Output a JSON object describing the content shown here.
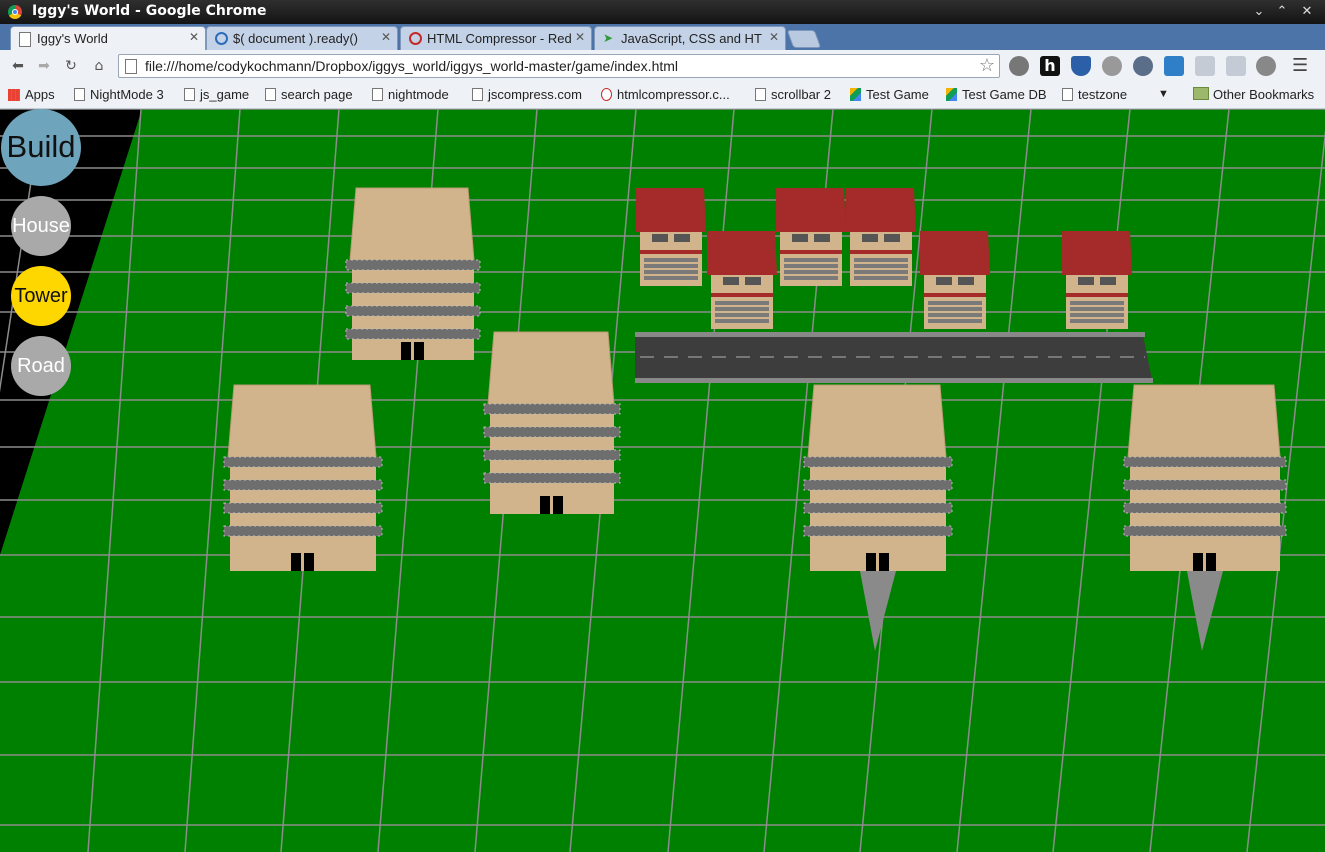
{
  "window": {
    "title": "Iggy's World - Google Chrome"
  },
  "tabs": [
    {
      "label": "Iggy's World",
      "active": true
    },
    {
      "label": "$( document ).ready()",
      "active": false
    },
    {
      "label": "HTML Compressor - Red",
      "active": false
    },
    {
      "label": "JavaScript, CSS and HT",
      "active": false
    }
  ],
  "address_bar": {
    "url": "file:///home/codykochmann/Dropbox/iggys_world/iggys_world-master/game/index.html"
  },
  "bookmarks": {
    "apps_label": "Apps",
    "items": [
      "NightMode 3",
      "js_game",
      "search page",
      "nightmode",
      "jscompress.com",
      "htmlcompressor.c...",
      "scrollbar 2",
      "Test Game",
      "Test Game DB",
      "testzone"
    ],
    "other_label": "Other Bookmarks"
  },
  "build_menu": {
    "build_label": "Build",
    "house_label": "House",
    "tower_label": "Tower",
    "road_label": "Road",
    "colors": {
      "build": "#6fa4bd",
      "house": "#a9a9a9",
      "tower": "#ffd700",
      "road": "#a9a9a9"
    }
  },
  "scene": {
    "ground_color": "#008000",
    "grid_color": "#8c8c8c",
    "tower_wall": "#d2b48c",
    "roof_color": "#a52a2a"
  }
}
